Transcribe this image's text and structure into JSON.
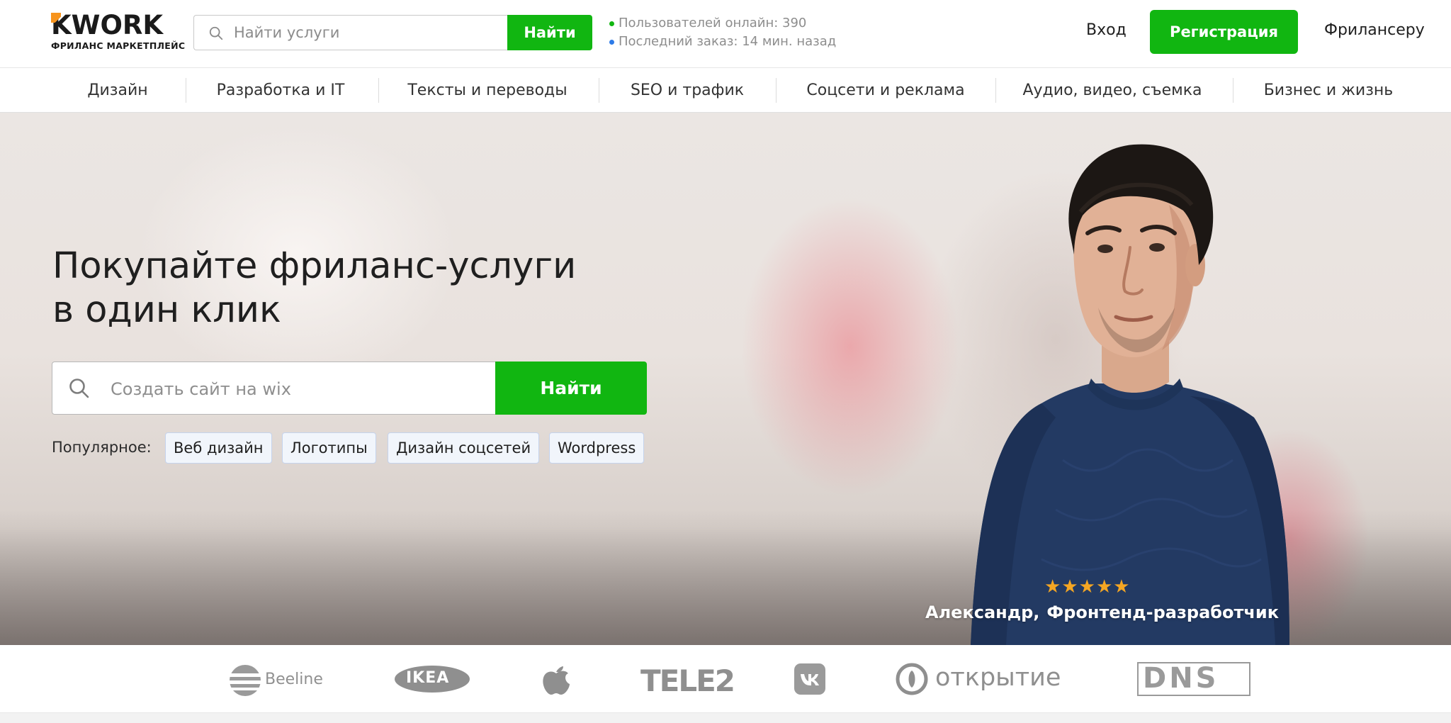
{
  "header": {
    "logo_text": "KWORK",
    "logo_subtitle": "ФРИЛАНС МАРКЕТПЛЕЙС",
    "search": {
      "placeholder": "Найти услуги",
      "value": "",
      "button_label": "Найти"
    },
    "stats": [
      {
        "text": "Пользователей онлайн: 390",
        "dot_color": "#11b611"
      },
      {
        "text": "Последний заказ: 14 мин. назад",
        "dot_color": "#2d7be8"
      }
    ],
    "login_label": "Вход",
    "register_label": "Регистрация",
    "freelancer_label": "Фрилансеру"
  },
  "categories": [
    "Дизайн",
    "Разработка и IT",
    "Тексты и переводы",
    "SEO и трафик",
    "Соцсети и реклама",
    "Аудио, видео, съемка",
    "Бизнес и жизнь"
  ],
  "hero": {
    "title_line1": "Покупайте фриланс-услуги",
    "title_line2": "в один клик",
    "search": {
      "placeholder": "Создать сайт на wix",
      "value": "",
      "button_label": "Найти"
    },
    "popular_label": "Популярное:",
    "popular_tags": [
      "Веб дизайн",
      "Логотипы",
      "Дизайн соцсетей",
      "Wordpress"
    ],
    "rating_stars": 5,
    "person_name": "Александр,",
    "person_role": "Фронтенд-разработчик"
  },
  "brands": [
    "Beeline",
    "IKEA",
    "apple-logo",
    "TELE2",
    "vk-logo",
    "открытие",
    "DNS"
  ],
  "colors": {
    "accent_green": "#11b611",
    "star": "#f5a623",
    "tag_bg": "#f1f5fb",
    "tag_border": "#c5d3ec",
    "brand_gray": "#8f8f8f"
  }
}
